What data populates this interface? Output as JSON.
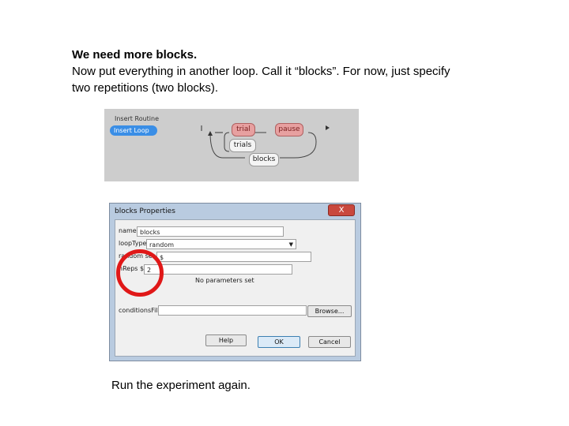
{
  "instructions": {
    "heading": "We need more blocks.",
    "line1": "Now put everything in another loop.  Call it “blocks”.  For now, just specify",
    "line2": "two repetitions (two blocks)."
  },
  "flow": {
    "insert_routine_label": "Insert Routine",
    "insert_loop_label": "Insert Loop",
    "routines": [
      "trial",
      "pause"
    ],
    "loops": [
      "trials",
      "blocks"
    ]
  },
  "dialog": {
    "title": "blocks Properties",
    "close_label": "X",
    "fields": {
      "name_label": "name",
      "name_value": "blocks",
      "looptype_label": "loopType",
      "looptype_value": "random",
      "nreps_label": "nReps $",
      "nreps_value": "2",
      "random_seed_label": "random seed $",
      "random_seed_value": "$",
      "conditions_label": "conditionsFile"
    },
    "no_params": "No parameters set",
    "buttons": {
      "browse": "Browse...",
      "help": "Help",
      "ok": "OK",
      "cancel": "Cancel"
    },
    "highlight_color": "#e01818"
  },
  "footer": "Run the experiment again."
}
